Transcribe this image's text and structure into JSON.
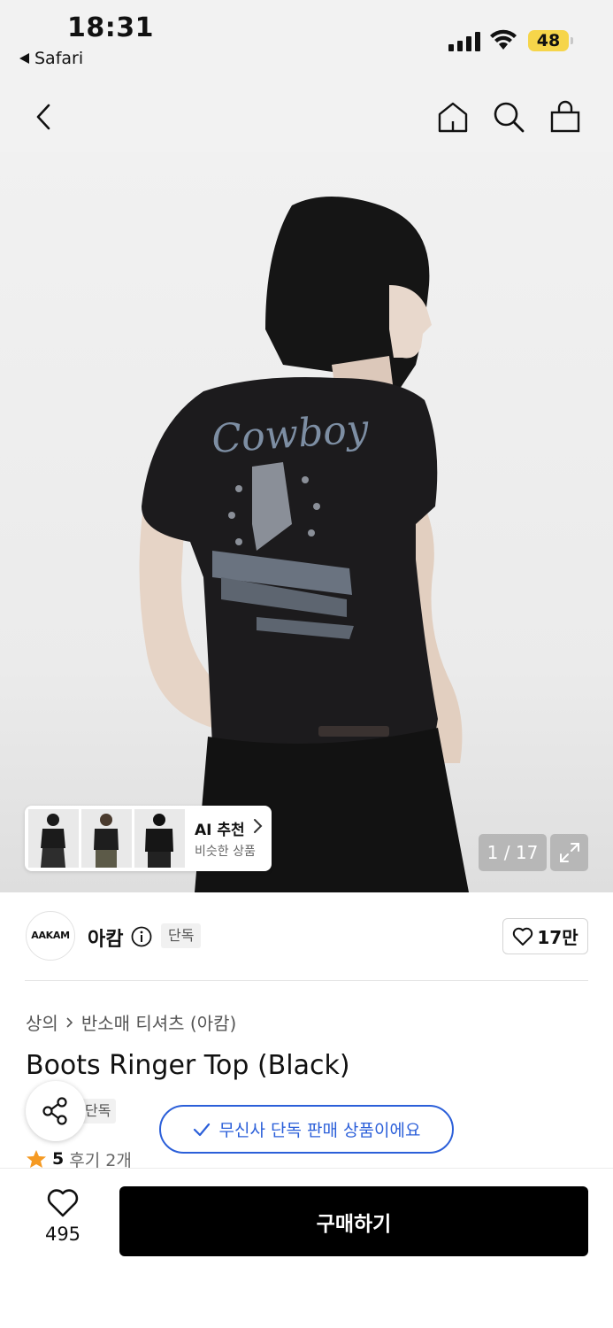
{
  "status_bar": {
    "time": "18:31",
    "back_app": "Safari",
    "battery": "48",
    "battery_color": "#f6d54a"
  },
  "nav": {
    "back_icon": "chevron-left-icon",
    "home_icon": "home-icon",
    "search_icon": "search-icon",
    "cart_icon": "shopping-bag-icon"
  },
  "hero": {
    "ai_title": "AI 추천",
    "ai_subtitle": "비슷한 상품",
    "counter": "1 / 17"
  },
  "brand": {
    "logo_text": "AAKAM",
    "name": "아캄",
    "badge": "단독",
    "likes": "17만"
  },
  "breadcrumb": {
    "items": [
      "상의",
      "반소매 티셔츠 (아캄)"
    ]
  },
  "product": {
    "title": "Boots Ringer Top (Black)",
    "badge": "단독",
    "rating": "5",
    "reviews": "후기 2개"
  },
  "toast": {
    "text": "무신사 단독 판매 상품이에요",
    "color": "#2b5fd9"
  },
  "bottom_bar": {
    "wish_count": "495",
    "buy_label": "구매하기"
  }
}
